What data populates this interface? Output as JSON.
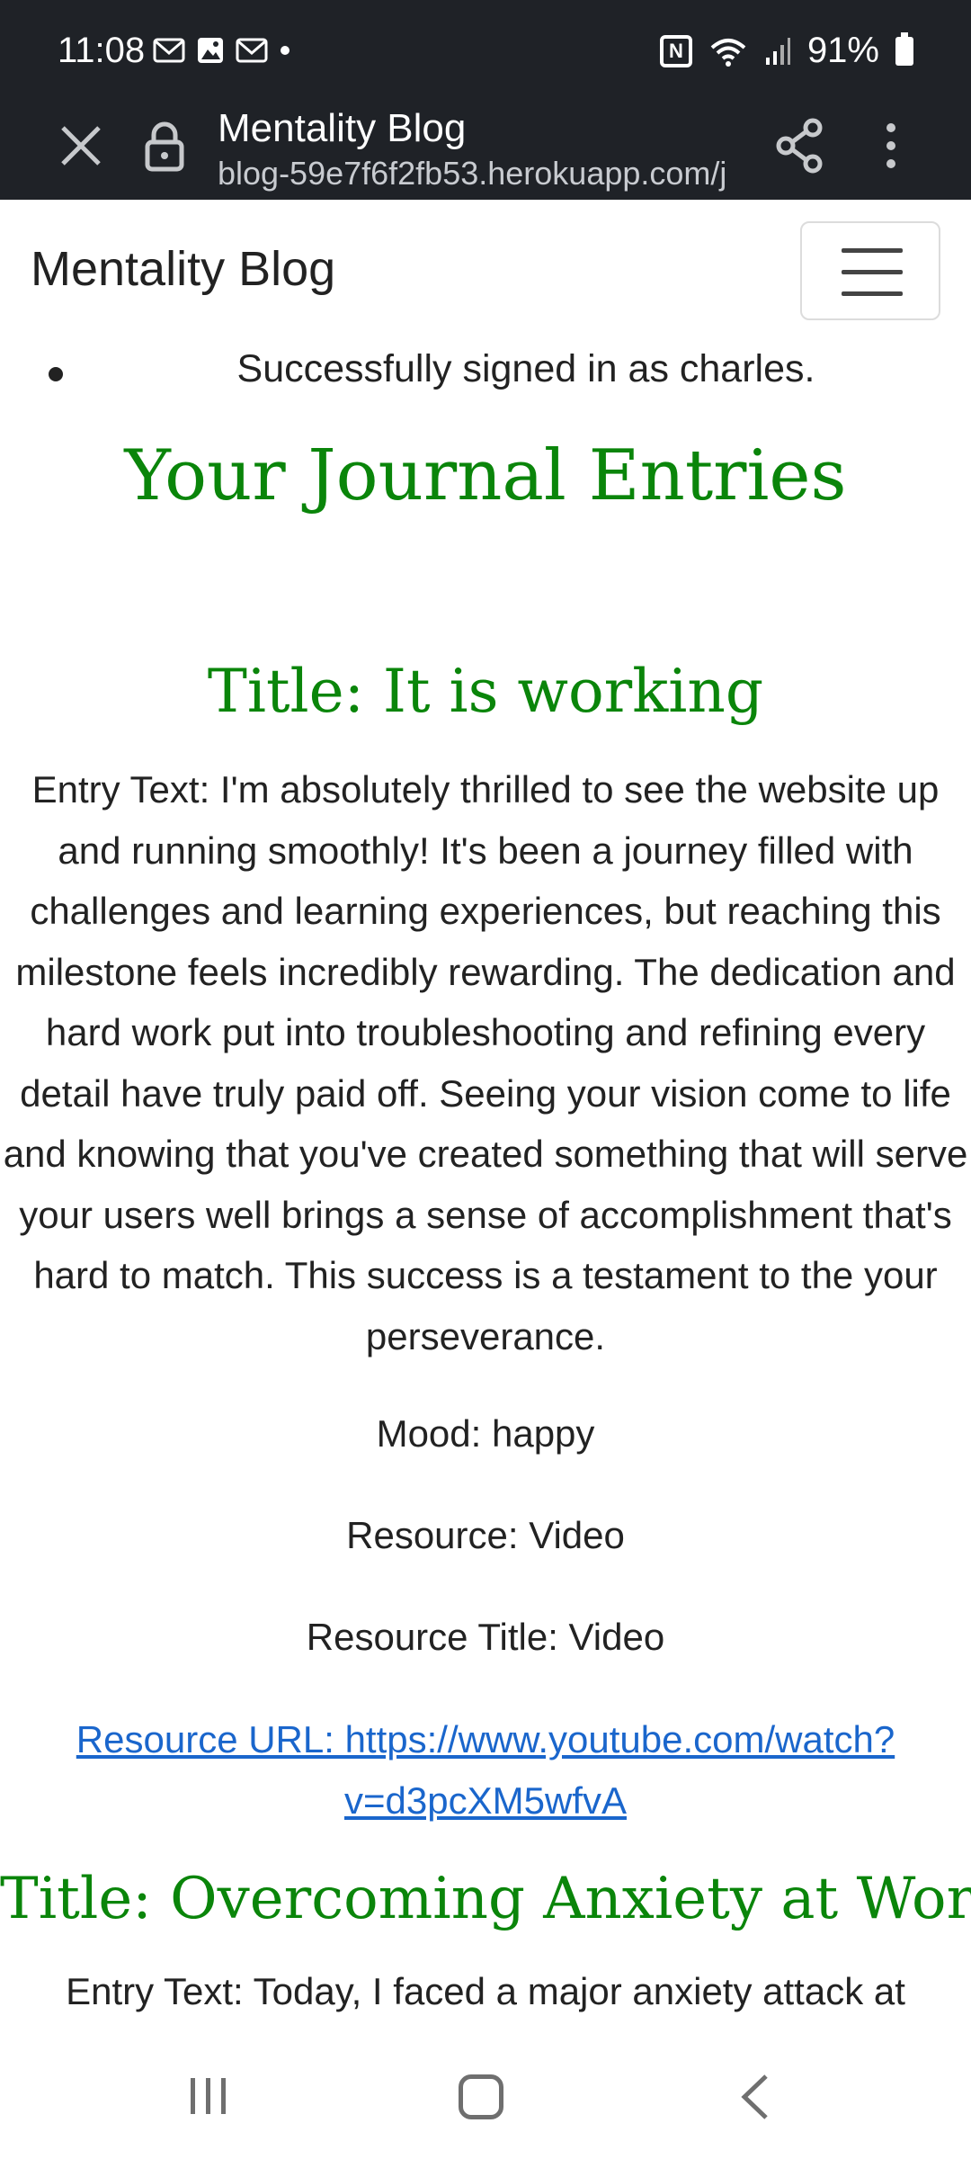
{
  "status_bar": {
    "time": "11:08",
    "battery": "91%",
    "left_icons": [
      "gmail-icon",
      "gallery-icon",
      "gmail-icon",
      "dot-icon"
    ],
    "right_icons": [
      "nfc-icon",
      "wifi-icon",
      "signal-icon",
      "battery-icon"
    ]
  },
  "browser": {
    "page_title": "Mentality Blog",
    "url": "blog-59e7f6f2fb53.herokuapp.com/j"
  },
  "site": {
    "brand": "Mentality Blog",
    "flash_message": "Successfully signed in as charles.",
    "heading": "Your Journal Entries"
  },
  "entries": [
    {
      "title": "Title: It is working",
      "text": "Entry Text: I'm absolutely thrilled to see the website up and running smoothly! It's been a journey filled with challenges and learning experiences, but reaching this milestone feels incredibly rewarding. The dedication and hard work put into troubleshooting and refining every detail have truly paid off. Seeing your vision come to life and knowing that you've created something that will serve your users well brings a sense of accomplishment that's hard to match. This success is a testament to the your perseverance.",
      "mood": "Mood: happy",
      "resource": "Resource: Video",
      "resource_title": "Resource Title: Video",
      "resource_url_line1": "Resource URL: https://www.youtube.com/watch?",
      "resource_url_line2": "v=d3pcXM5wfvA"
    },
    {
      "title": "Title: Overcoming Anxiety at Work",
      "text": "Entry Text: Today, I faced a major anxiety attack at"
    }
  ],
  "colors": {
    "status_bg": "#1f2227",
    "heading_green": "#0a850a",
    "link_blue": "#1a66cc"
  }
}
